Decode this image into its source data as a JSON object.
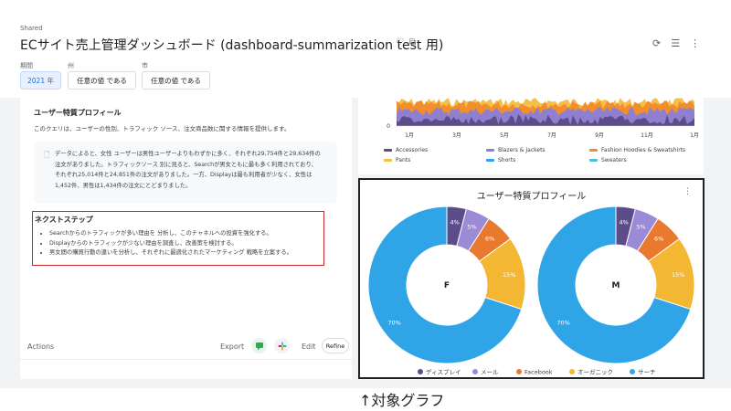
{
  "header": {
    "shared_label": "Shared",
    "title": "ECサイト売上管理ダッシュボード (dashboard-summarization test 用)"
  },
  "filters": [
    {
      "label": "期間",
      "value": "2021 年"
    },
    {
      "label": "州",
      "value": "任意の値 である"
    },
    {
      "label": "市",
      "value": "任意の値 である"
    }
  ],
  "left_panel": {
    "section_title": "ユーザー特質プロフィール",
    "section_desc": "このクエリは、ユーザーの性別、トラフィック ソース、注文商品数に関する情報を提供します。",
    "summary_lines": [
      "データによると、女性 ユーザーは男性ユーザーよりもわずかに多く、それぞれ29,754件と29,634件の",
      "注文がありました。トラフィックソース 別に見ると、Searchが男女ともに最も多く利用されており、",
      "それぞれ25,014件と24,851件の注文がありました。一方、Displayは最も利用者が少なく、女性は",
      "1,452件、男性は1,434件の注文にとどまりました。"
    ],
    "next_title": "ネクストステップ",
    "next_steps": [
      "Searchからのトラフィックが多い理由を 分析し、このチャネルへの投資を強化する。",
      "Displayからのトラフィックが少ない理由を調査し、改善策を検討する。",
      "男女間の購買行動の違いを分析し、それぞれに最適化されたマーケティング 戦略を立案する。"
    ],
    "actions_label": "Actions",
    "export_label": "Export",
    "edit_label": "Edit",
    "refine_label": "Refine"
  },
  "top_chart": {
    "y_tick": "0",
    "x_ticks": [
      "1月",
      "3月",
      "5月",
      "7月",
      "9月",
      "11月",
      "1月"
    ],
    "legend": [
      {
        "name": "Accessories",
        "color": "#5c4d8a"
      },
      {
        "name": "Blazers & Jackets",
        "color": "#8f7fcf"
      },
      {
        "name": "Fashion Hoodies & Sweatshirts",
        "color": "#f28e2b"
      },
      {
        "name": "Pants",
        "color": "#f6bf49"
      },
      {
        "name": "Shorts",
        "color": "#2fa4e7"
      },
      {
        "name": "Sweaters",
        "color": "#46c3d7"
      }
    ]
  },
  "chart_data": {
    "type": "pie",
    "title": "ユーザー特質プロフィール",
    "categories": [
      "ディスプレイ",
      "メール",
      "Facebook",
      "オーガニック",
      "サーチ"
    ],
    "colors": [
      "#5c4d8a",
      "#9b8ad6",
      "#e8792f",
      "#f3b733",
      "#2fa4e7"
    ],
    "series": [
      {
        "name": "F",
        "values": [
          4,
          5,
          6,
          15,
          70
        ]
      },
      {
        "name": "M",
        "values": [
          4,
          5,
          6,
          15,
          70
        ]
      }
    ],
    "unit": "%"
  },
  "caption": "↑対象グラフ"
}
